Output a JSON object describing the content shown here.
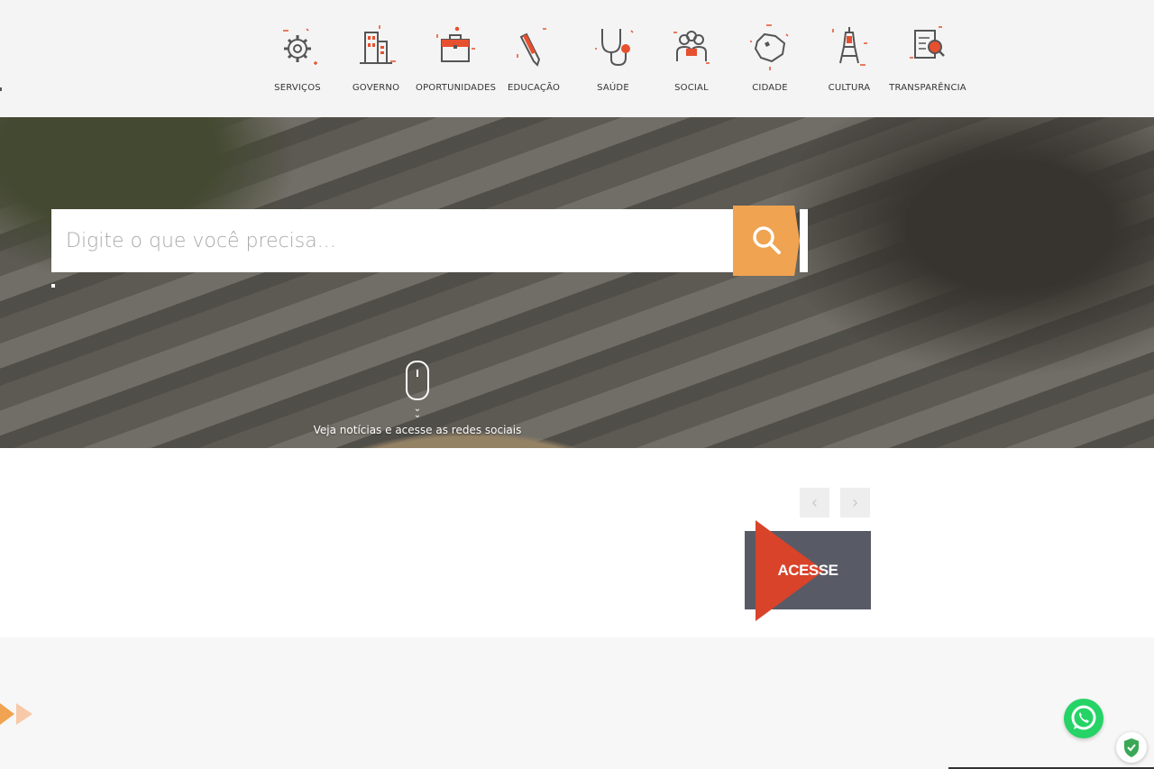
{
  "nav": {
    "items": [
      {
        "label": "SERVIÇOS",
        "icon": "gear-icon"
      },
      {
        "label": "GOVERNO",
        "icon": "buildings-icon"
      },
      {
        "label": "OPORTUNIDADES",
        "icon": "briefcase-icon"
      },
      {
        "label": "EDUCAÇÃO",
        "icon": "pencil-icon"
      },
      {
        "label": "SAÚDE",
        "icon": "stethoscope-icon"
      },
      {
        "label": "SOCIAL",
        "icon": "people-group-icon"
      },
      {
        "label": "CIDADE",
        "icon": "city-map-icon"
      },
      {
        "label": "CULTURA",
        "icon": "tower-icon"
      },
      {
        "label": "TRANSPARÊNCIA",
        "icon": "document-magnifier-icon"
      }
    ]
  },
  "search": {
    "placeholder": "Digite o que você precisa..."
  },
  "hero": {
    "scroll_hint": "Veja notícias e acesse as redes sociais"
  },
  "news": {
    "prev_label": "‹",
    "next_label": "›",
    "acesse_label": "ACESSE"
  },
  "colors": {
    "accent_orange": "#f0a350",
    "accent_red": "#d9432a",
    "slate": "#585b66",
    "whatsapp_green": "#25d366"
  }
}
